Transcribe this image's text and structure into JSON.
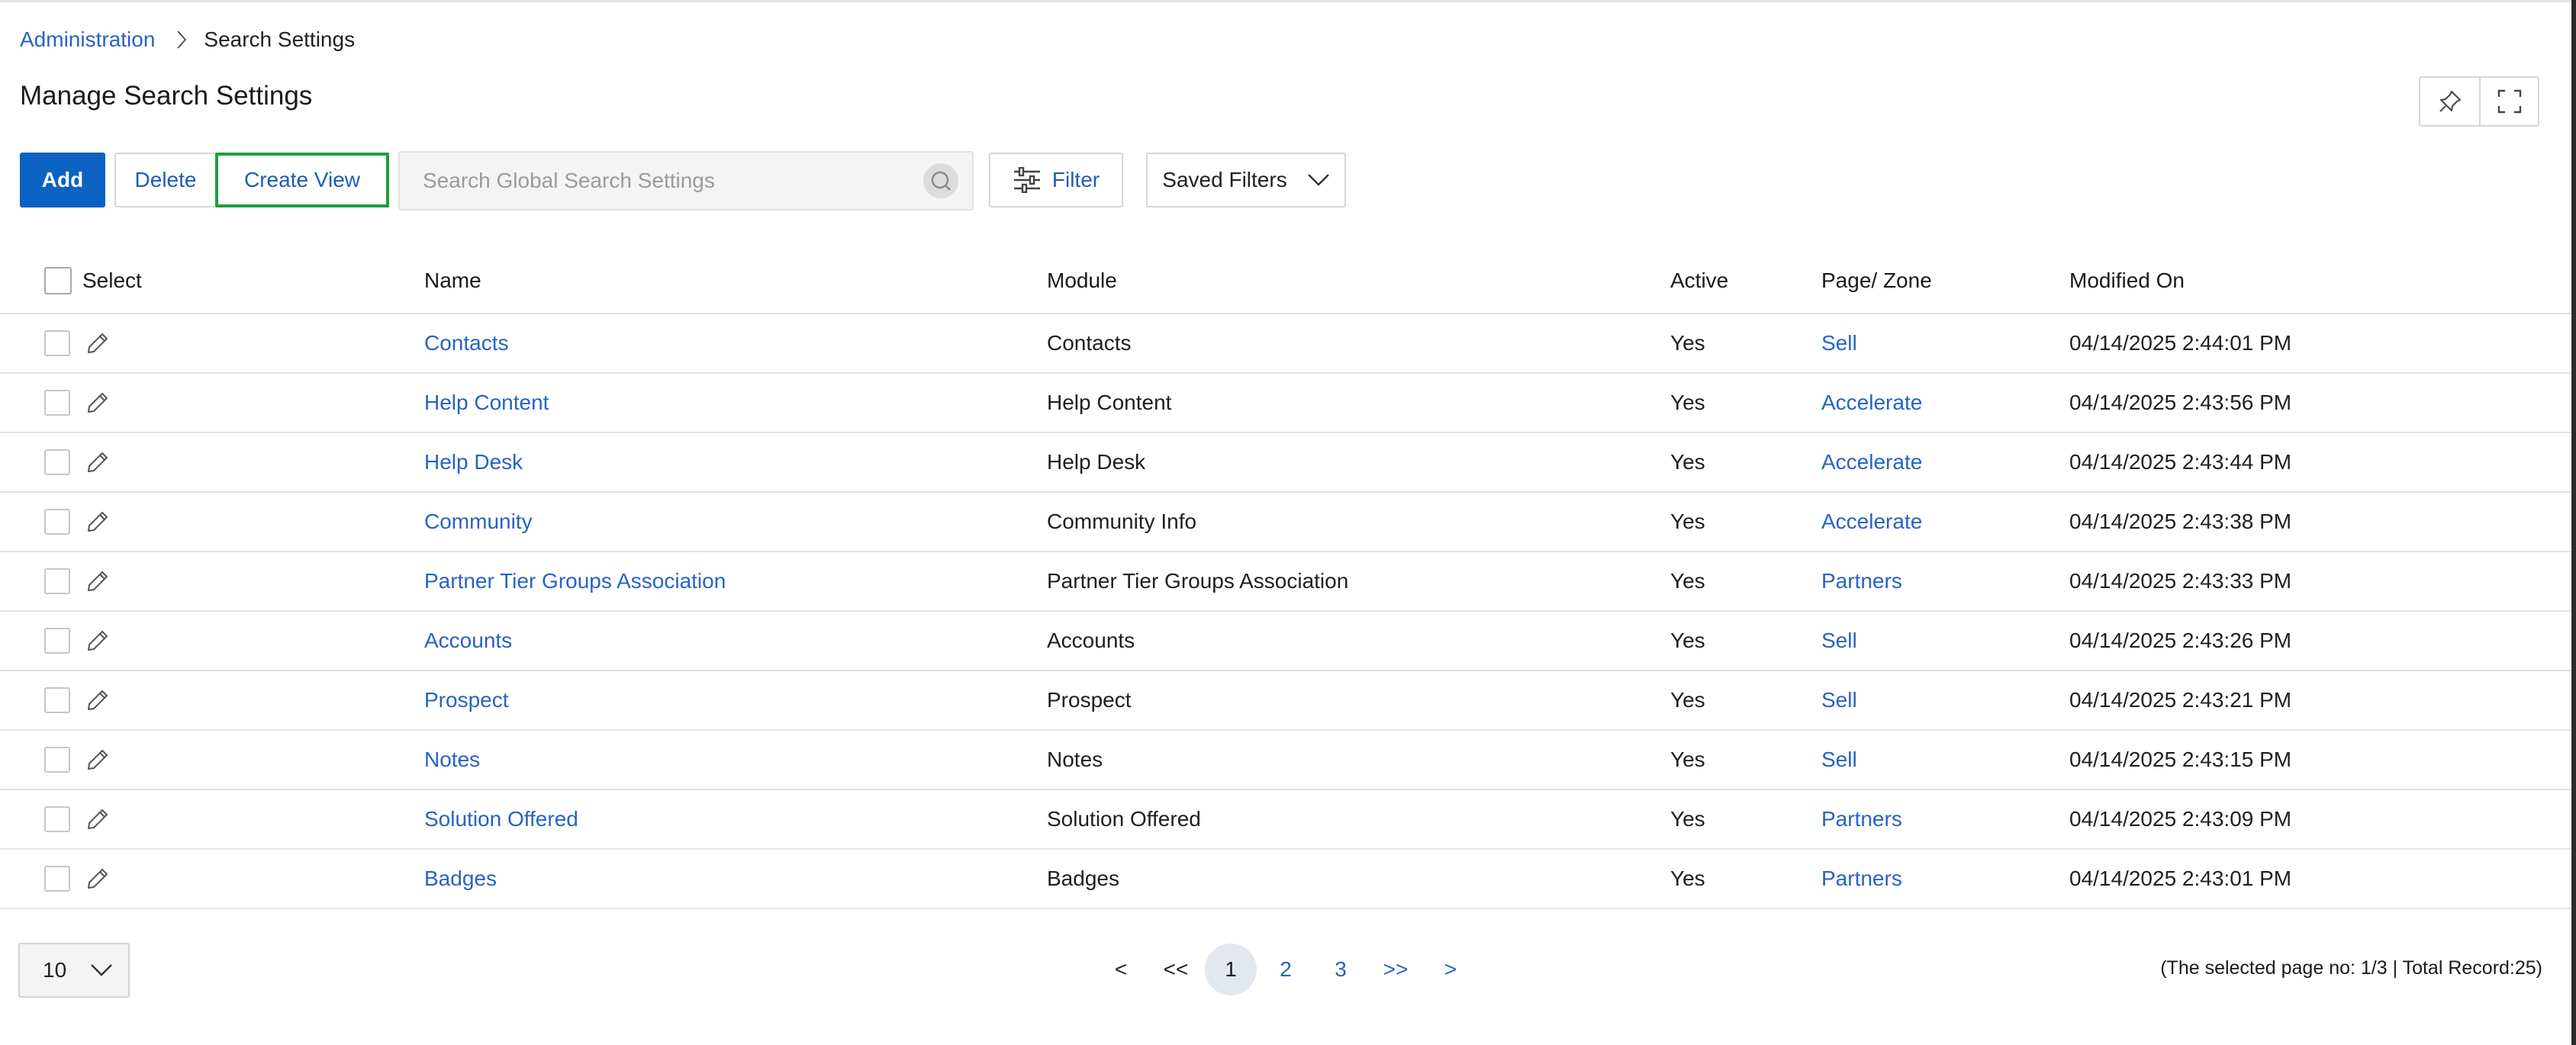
{
  "breadcrumb": {
    "root": "Administration",
    "current": "Search Settings"
  },
  "page": {
    "title": "Manage Search Settings"
  },
  "toolbar": {
    "add": "Add",
    "delete": "Delete",
    "create_view": "Create View",
    "search_placeholder": "Search Global Search Settings",
    "filter": "Filter",
    "saved_filters": "Saved Filters"
  },
  "icons": {
    "pin": "pin-icon",
    "fullscreen": "fullscreen-icon",
    "search": "search-icon",
    "filter": "sliders-icon",
    "chevron": "chevron-down-icon",
    "edit": "pencil-icon",
    "breadcrumb_sep": "chevron-right-icon"
  },
  "colors": {
    "primary": "#0b62c3",
    "link": "#2962c4",
    "highlight": "#1e9e3e"
  },
  "table": {
    "columns": {
      "select": "Select",
      "name": "Name",
      "module": "Module",
      "active": "Active",
      "zone": "Page/ Zone",
      "modified": "Modified On"
    },
    "rows": [
      {
        "name": "Contacts",
        "module": "Contacts",
        "active": "Yes",
        "zone": "Sell",
        "modified": "04/14/2025 2:44:01 PM"
      },
      {
        "name": "Help Content",
        "module": "Help Content",
        "active": "Yes",
        "zone": "Accelerate",
        "modified": "04/14/2025 2:43:56 PM"
      },
      {
        "name": "Help Desk",
        "module": "Help Desk",
        "active": "Yes",
        "zone": "Accelerate",
        "modified": "04/14/2025 2:43:44 PM"
      },
      {
        "name": "Community",
        "module": "Community Info",
        "active": "Yes",
        "zone": "Accelerate",
        "modified": "04/14/2025 2:43:38 PM"
      },
      {
        "name": "Partner Tier Groups Association",
        "module": "Partner Tier Groups Association",
        "active": "Yes",
        "zone": "Partners",
        "modified": "04/14/2025 2:43:33 PM"
      },
      {
        "name": "Accounts",
        "module": "Accounts",
        "active": "Yes",
        "zone": "Sell",
        "modified": "04/14/2025 2:43:26 PM"
      },
      {
        "name": "Prospect",
        "module": "Prospect",
        "active": "Yes",
        "zone": "Sell",
        "modified": "04/14/2025 2:43:21 PM"
      },
      {
        "name": "Notes",
        "module": "Notes",
        "active": "Yes",
        "zone": "Sell",
        "modified": "04/14/2025 2:43:15 PM"
      },
      {
        "name": "Solution Offered",
        "module": "Solution Offered",
        "active": "Yes",
        "zone": "Partners",
        "modified": "04/14/2025 2:43:09 PM"
      },
      {
        "name": "Badges",
        "module": "Badges",
        "active": "Yes",
        "zone": "Partners",
        "modified": "04/14/2025 2:43:01 PM"
      }
    ]
  },
  "pagination": {
    "page_size": "10",
    "prev": "<",
    "first": "<<",
    "pages": [
      "1",
      "2",
      "3"
    ],
    "current_page": "1",
    "last": ">>",
    "next": ">",
    "info": "(The selected page no: 1/3 | Total Record:25)"
  }
}
